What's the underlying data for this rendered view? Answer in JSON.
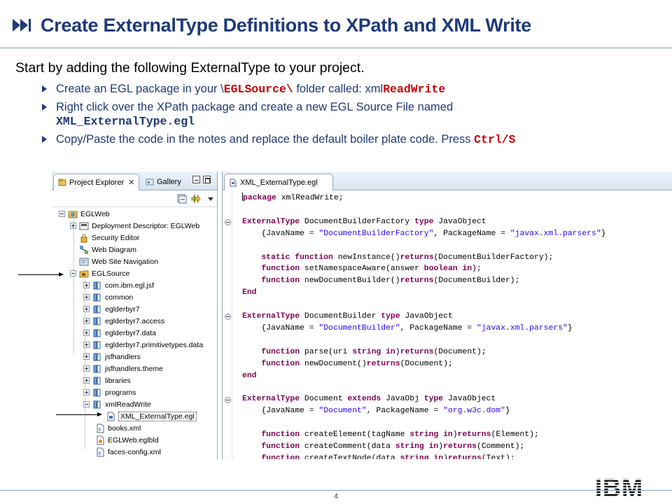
{
  "slide": {
    "title": "Create ExternalType Definitions to XPath and XML Write",
    "intro": "Start by adding the following ExternalType to your project.",
    "bullets": [
      {
        "pre": "Create an EGL package in your \\",
        "code1": "EGLSource\\",
        "mid": " folder called: xml",
        "code2": "ReadWrite"
      },
      {
        "pre": "Right click over the XPath package and create a new EGL Source File named",
        "code1": "XML_ExternalType.egl"
      },
      {
        "pre": "Copy/Paste the code in the notes and replace the default boiler plate code.  Press ",
        "code1": "Ctrl/S"
      }
    ],
    "page_number": "4",
    "logo": "IBM",
    "colors": {
      "title": "#1f3a78",
      "accent_red": "#cc0000",
      "keyword": "#7f0055",
      "string": "#2a00ff"
    }
  },
  "explorer": {
    "tabs": [
      {
        "label": "Project Explorer",
        "icon": "project-explorer-icon",
        "close": "✕"
      },
      {
        "label": "Gallery",
        "icon": "gallery-icon"
      }
    ],
    "toolbar": [
      "collapse-all-icon",
      "link-with-editor-icon",
      "view-menu-icon"
    ],
    "tree": [
      {
        "label": "EGLWeb",
        "icon": "web-project-icon"
      },
      {
        "label": "Deployment Descriptor: EGLWeb",
        "icon": "deployment-descriptor-icon"
      },
      {
        "label": "Security Editor",
        "icon": "security-editor-icon"
      },
      {
        "label": "Web Diagram",
        "icon": "web-diagram-icon"
      },
      {
        "label": "Web Site Navigation",
        "icon": "web-site-navigation-icon"
      },
      {
        "label": "EGLSource",
        "icon": "source-folder-icon"
      },
      {
        "label": "com.ibm.egl.jsf",
        "icon": "package-icon"
      },
      {
        "label": "common",
        "icon": "package-icon"
      },
      {
        "label": "eglderbyr7",
        "icon": "package-icon"
      },
      {
        "label": "eglderbyr7.access",
        "icon": "package-icon"
      },
      {
        "label": "eglderbyr7.data",
        "icon": "package-icon"
      },
      {
        "label": "eglderbyr7.primitivetypes.data",
        "icon": "package-icon"
      },
      {
        "label": "jsfhandlers",
        "icon": "package-icon"
      },
      {
        "label": "jsfhandlers.theme",
        "icon": "package-icon"
      },
      {
        "label": "libraries",
        "icon": "package-icon"
      },
      {
        "label": "programs",
        "icon": "package-icon"
      },
      {
        "label": "xmlReadWrite",
        "icon": "package-icon"
      },
      {
        "label": "XML_ExternalType.egl",
        "icon": "egl-file-icon"
      },
      {
        "label": "books.xml",
        "icon": "xml-file-icon"
      },
      {
        "label": "EGLWeb.eglbld",
        "icon": "build-descriptor-icon"
      },
      {
        "label": "faces-config.xml",
        "icon": "xml-file-icon"
      }
    ]
  },
  "editor": {
    "tab_label": "XML_ExternalType.egl",
    "tab_icon": "egl-file-icon"
  }
}
